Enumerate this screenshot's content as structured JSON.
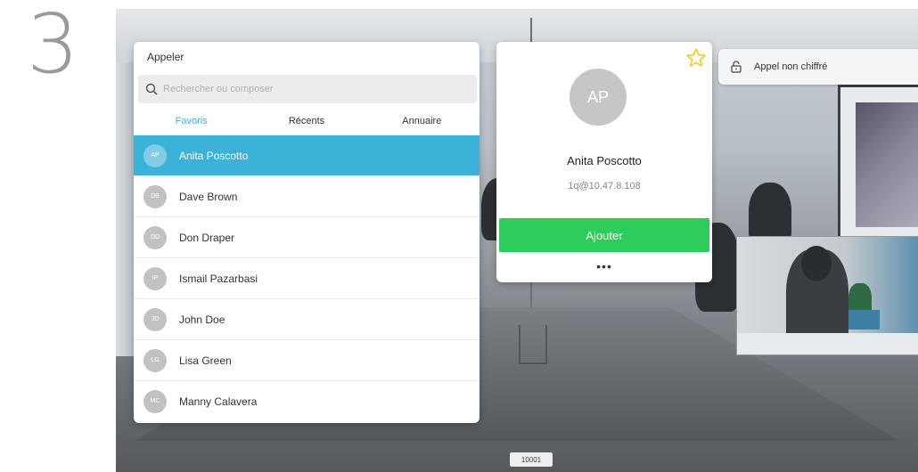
{
  "step_number": "3",
  "call_panel": {
    "title": "Appeler",
    "search_placeholder": "Rechercher ou composer",
    "tabs": [
      {
        "label": "Favoris",
        "active": true
      },
      {
        "label": "Récents",
        "active": false
      },
      {
        "label": "Annuaire",
        "active": false
      }
    ],
    "contacts": [
      {
        "initials": "AP",
        "name": "Anita Poscotto",
        "selected": true
      },
      {
        "initials": "DB",
        "name": "Dave Brown"
      },
      {
        "initials": "DD",
        "name": "Don Draper"
      },
      {
        "initials": "IP",
        "name": "Ismail Pazarbasi"
      },
      {
        "initials": "JD",
        "name": "John Doe"
      },
      {
        "initials": "LG",
        "name": "Lisa Green"
      },
      {
        "initials": "MC",
        "name": "Manny Calavera"
      }
    ]
  },
  "contact_card": {
    "initials": "AP",
    "name": "Anita Poscotto",
    "address": "1q@10.47.8.108",
    "add_label": "Ajouter",
    "more_label": "•••"
  },
  "encryption": {
    "label": "Appel non chiffré"
  },
  "call_id": "10001",
  "colors": {
    "accent": "#3cb2d8",
    "add_button": "#2ecc5b",
    "star": "#f5c518"
  },
  "icons": [
    "search-icon",
    "lock-icon",
    "star-icon",
    "more-icon"
  ]
}
